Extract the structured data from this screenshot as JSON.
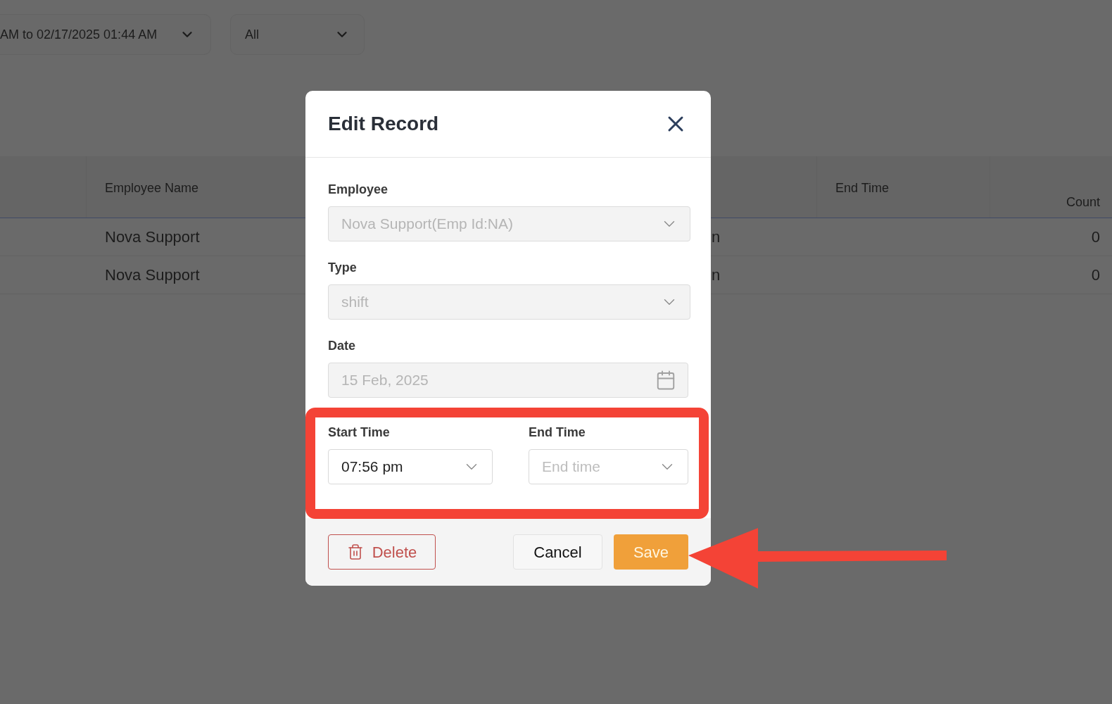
{
  "filters": [
    {
      "value": "AM to 02/17/2025 01:44 AM"
    },
    {
      "value": "All"
    }
  ],
  "table": {
    "columns": [
      {
        "label": "Employee Name"
      },
      {
        "label": "End Time"
      },
      {
        "label": "Count"
      }
    ],
    "rows": [
      {
        "employee_name": "Nova Support",
        "column_3": "n",
        "count": "0"
      },
      {
        "employee_name": "Nova Support",
        "column_3": "n",
        "count": "0"
      }
    ]
  },
  "dialog": {
    "title": "Edit Record",
    "fields": [
      {
        "kind": "select",
        "label": "Employee",
        "value": "Nova Support(Emp Id:NA)",
        "disabled": true
      },
      {
        "kind": "select",
        "label": "Type",
        "value": "shift",
        "disabled": true
      },
      {
        "kind": "date",
        "label": "Date",
        "value": "15 Feb, 2025",
        "disabled": true
      }
    ],
    "time_fields": [
      {
        "label": "Start Time",
        "value": "07:56 pm",
        "disabled": false
      },
      {
        "label": "End Time",
        "placeholder": "End time",
        "disabled": false
      }
    ],
    "buttons": [
      {
        "kind": "delete",
        "label": "Delete"
      },
      {
        "kind": "cancel",
        "label": "Cancel"
      },
      {
        "kind": "save",
        "label": "Save"
      }
    ]
  },
  "annotations": {
    "highlight_frame": {
      "color": "#f44336"
    },
    "arrow": {
      "color": "#f44336"
    }
  }
}
